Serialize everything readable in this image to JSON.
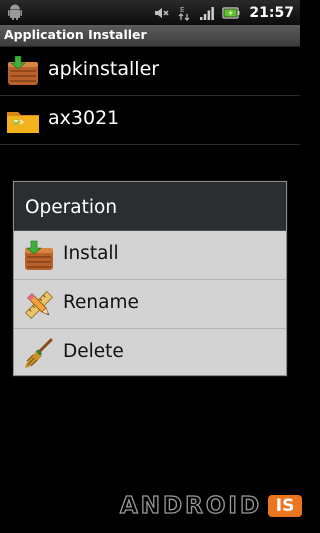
{
  "status_bar": {
    "time": "21:57",
    "icons": [
      "android-notification-icon",
      "mute-icon",
      "data-arrows-icon",
      "signal-icon",
      "battery-icon"
    ],
    "battery_color": "#5ec22a"
  },
  "app": {
    "title": "Application Installer"
  },
  "files": [
    {
      "label": "apkinstaller",
      "icon": "package-box-icon"
    },
    {
      "label": "ax3021",
      "icon": "folder-icon"
    }
  ],
  "dialog": {
    "title": "Operation",
    "items": [
      {
        "label": "Install",
        "icon": "install-box-icon"
      },
      {
        "label": "Rename",
        "icon": "pencil-ruler-icon"
      },
      {
        "label": "Delete",
        "icon": "broom-icon"
      }
    ]
  },
  "watermark": {
    "text": "ANDROID",
    "badge": "IS",
    "badge_color": "#ec7520"
  }
}
